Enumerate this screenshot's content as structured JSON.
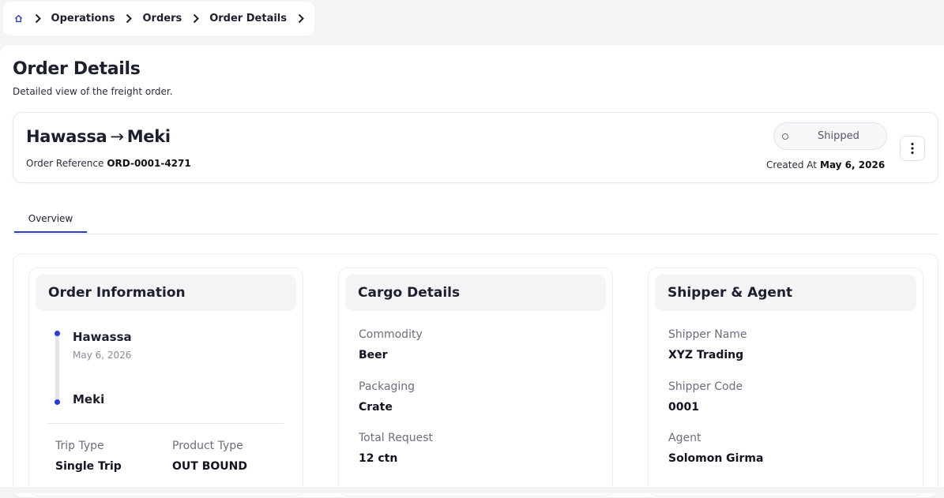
{
  "breadcrumb": {
    "items": [
      "Operations",
      "Orders",
      "Order Details"
    ]
  },
  "page": {
    "title": "Order Details",
    "subtitle": "Detailed view of the freight order."
  },
  "summary": {
    "origin": "Hawassa",
    "arrow": "→",
    "destination": "Meki",
    "order_ref_label": "Order Reference",
    "order_ref_value": "ORD-0001-4271",
    "status": "Shipped",
    "created_at_label": "Created At",
    "created_at_value": "May 6, 2026"
  },
  "tabs": [
    {
      "label": "Overview",
      "active": true
    }
  ],
  "order_information": {
    "title": "Order Information",
    "origin": "Hawassa",
    "origin_date": "May 6, 2026",
    "destination": "Meki",
    "trip_type_label": "Trip Type",
    "trip_type_value": "Single Trip",
    "product_type_label": "Product Type",
    "product_type_value": "OUT BOUND"
  },
  "cargo_details": {
    "title": "Cargo Details",
    "commodity_label": "Commodity",
    "commodity_value": "Beer",
    "packaging_label": "Packaging",
    "packaging_value": "Crate",
    "total_request_label": "Total Request",
    "total_request_value": "12 ctn"
  },
  "shipper_agent": {
    "title": "Shipper & Agent",
    "shipper_name_label": "Shipper Name",
    "shipper_name_value": "XYZ Trading",
    "shipper_code_label": "Shipper Code",
    "shipper_code_value": "0001",
    "agent_label": "Agent",
    "agent_value": "Solomon Girma"
  },
  "colors": {
    "accent": "#2d3ad8",
    "text": "#1c1f2e",
    "muted": "#6b6e7c",
    "background": "#f4f4f6"
  },
  "icons": {
    "home": "home-icon",
    "separator": "chevron-right-icon",
    "more": "more-vertical-icon",
    "status": "status-circle-icon"
  }
}
